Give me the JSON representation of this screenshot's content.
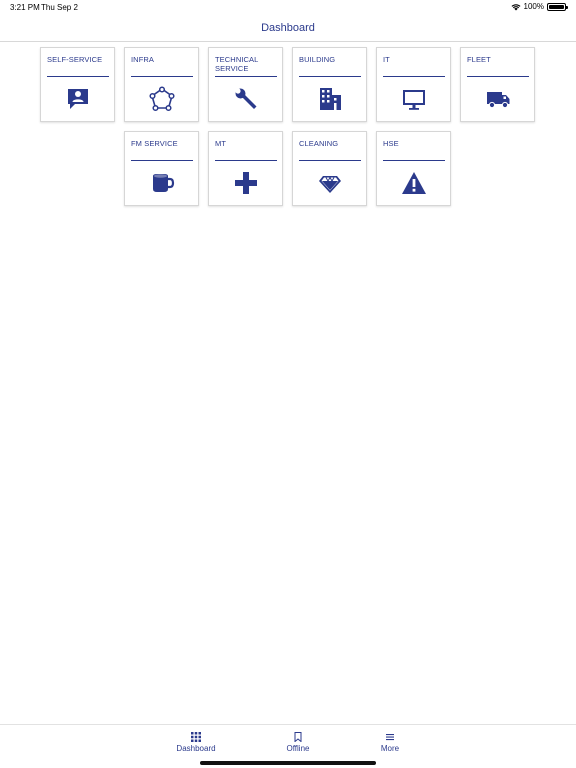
{
  "status_bar": {
    "time": "3:21 PM",
    "date": "Thu Sep 2",
    "battery_percent": "100%",
    "wifi_icon": "wifi-icon",
    "battery_icon": "battery-full-icon"
  },
  "nav": {
    "title": "Dashboard"
  },
  "colors": {
    "accent": "#2b3a8c",
    "tile_border": "#d6d6d6",
    "background": "#ffffff"
  },
  "tiles": [
    {
      "label": "SELF-SERVICE",
      "icon": "chat-person-icon"
    },
    {
      "label": "INFRA",
      "icon": "network-nodes-icon"
    },
    {
      "label": "TECHNICAL SERVICE",
      "icon": "wrench-icon"
    },
    {
      "label": "BUILDING",
      "icon": "building-icon"
    },
    {
      "label": "IT",
      "icon": "monitor-icon"
    },
    {
      "label": "FLEET",
      "icon": "truck-icon"
    },
    {
      "label": "FM SERVICE",
      "icon": "coffee-mug-icon"
    },
    {
      "label": "MT",
      "icon": "medical-cross-icon"
    },
    {
      "label": "CLEANING",
      "icon": "diamond-icon"
    },
    {
      "label": "HSE",
      "icon": "warning-icon"
    }
  ],
  "tab_bar": {
    "tabs": [
      {
        "label": "Dashboard",
        "icon": "grid-icon",
        "selected": true
      },
      {
        "label": "Offline",
        "icon": "bookmark-icon",
        "selected": false
      },
      {
        "label": "More",
        "icon": "menu-icon",
        "selected": false
      }
    ]
  }
}
